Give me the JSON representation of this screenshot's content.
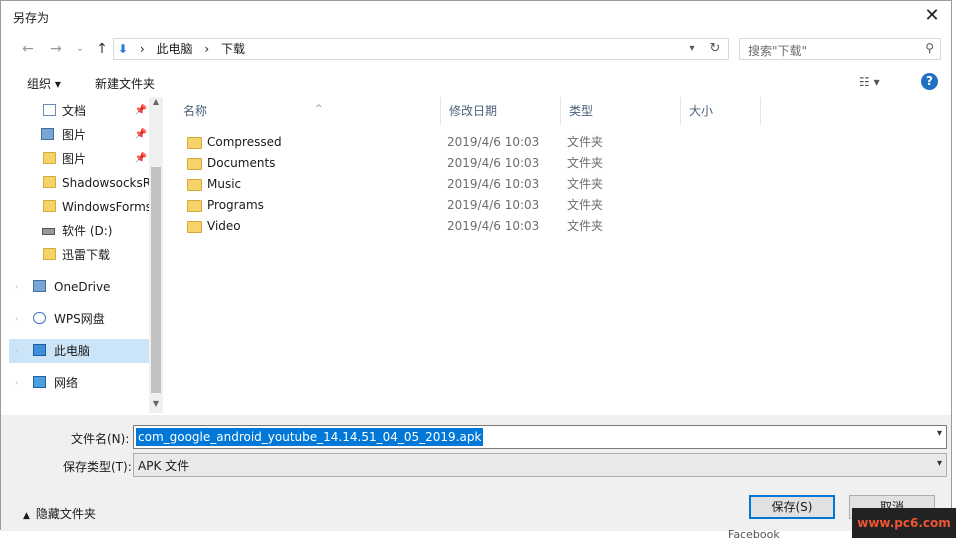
{
  "window": {
    "title": "另存为",
    "close": "✕"
  },
  "nav": {
    "back": "←",
    "forward": "→",
    "recent": "⌄",
    "up": "↑",
    "breadcrumbs": [
      "此电脑",
      "下载"
    ],
    "separator": "›",
    "search_placeholder": "搜索\"下载\""
  },
  "toolbar": {
    "organize": "组织 ▾",
    "new_folder": "新建文件夹",
    "view": "☷ ▾",
    "help": "?"
  },
  "sidebar": {
    "items": [
      {
        "label": "文档",
        "icon": "document-icon",
        "pinned": true
      },
      {
        "label": "图片",
        "icon": "picture-icon",
        "pinned": true
      },
      {
        "label": "图片",
        "icon": "folder-icon",
        "pinned": true
      },
      {
        "label": "ShadowsocksR",
        "icon": "folder-icon",
        "pinned": false
      },
      {
        "label": "WindowsForms",
        "icon": "folder-icon",
        "pinned": false
      },
      {
        "label": "软件 (D:)",
        "icon": "drive-icon",
        "pinned": false
      },
      {
        "label": "迅雷下载",
        "icon": "folder-icon",
        "pinned": false
      },
      {
        "label": "OneDrive",
        "icon": "onedrive-icon",
        "pinned": false
      },
      {
        "label": "WPS网盘",
        "icon": "cloud-icon",
        "pinned": false
      },
      {
        "label": "此电脑",
        "icon": "computer-icon",
        "pinned": false,
        "selected": true
      },
      {
        "label": "网络",
        "icon": "network-icon",
        "pinned": false
      }
    ]
  },
  "columns": {
    "name": "名称",
    "modified": "修改日期",
    "type": "类型",
    "size": "大小"
  },
  "files": [
    {
      "name": "Compressed",
      "modified": "2019/4/6 10:03",
      "type": "文件夹"
    },
    {
      "name": "Documents",
      "modified": "2019/4/6 10:03",
      "type": "文件夹"
    },
    {
      "name": "Music",
      "modified": "2019/4/6 10:03",
      "type": "文件夹"
    },
    {
      "name": "Programs",
      "modified": "2019/4/6 10:03",
      "type": "文件夹"
    },
    {
      "name": "Video",
      "modified": "2019/4/6 10:03",
      "type": "文件夹"
    }
  ],
  "save": {
    "filename_label": "文件名(N):",
    "filename_value": "com_google_android_youtube_14.14.51_04_05_2019.apk",
    "type_label": "保存类型(T):",
    "type_value": "APK 文件",
    "hide_folders": "隐藏文件夹",
    "save_button": "保存(S)",
    "cancel_button": "取消"
  },
  "background": {
    "facebook": "Facebook",
    "watermark": "www.pc6.com"
  }
}
